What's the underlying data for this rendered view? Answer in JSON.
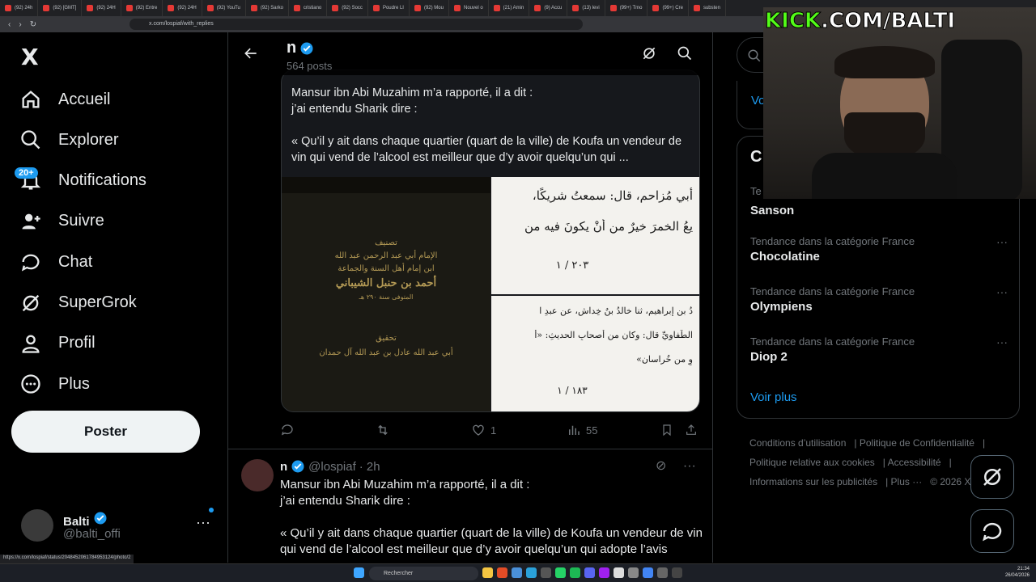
{
  "browser": {
    "tabs": [
      "(92) 24h",
      "(92) [GMT]",
      "(92) 24H",
      "(92) Entre",
      "(92) 24H",
      "(92) YouTu",
      "(92) Sarko",
      "cristiano",
      "(92) Socc",
      "Poudre LI",
      "(92) Mou",
      "Nouvel o",
      "(21) Amin",
      "(9) Accu",
      "(13) levi",
      "(99+) Tmo",
      "(99+) Cre",
      "substen"
    ],
    "url": "x.com/lospiaf/with_replies",
    "status_url": "https://x.com/lospiaf/status/2048452061784953124/photo/2"
  },
  "nav": {
    "logo": "X",
    "items": [
      {
        "label": "Accueil",
        "icon": "home-icon"
      },
      {
        "label": "Explorer",
        "icon": "search-icon"
      },
      {
        "label": "Notifications",
        "icon": "bell-icon"
      },
      {
        "label": "Suivre",
        "icon": "follow-icon"
      },
      {
        "label": "Chat",
        "icon": "chat-icon"
      },
      {
        "label": "SuperGrok",
        "icon": "grok-icon"
      },
      {
        "label": "Profil",
        "icon": "profile-icon"
      },
      {
        "label": "Plus",
        "icon": "more-icon"
      }
    ],
    "notif_badge": "20+",
    "post_label": "Poster",
    "account": {
      "name": "Balti",
      "handle": "@balti_offi"
    }
  },
  "header": {
    "name": "n",
    "posts": "564 posts"
  },
  "tweet1": {
    "quote_text_line1": "Mansur ibn Abi Muzahim m’a rapporté, il a dit :",
    "quote_text_line2": "j’ai entendu Sharik dire :",
    "quote_text_line3": "« Qu’il y ait dans chaque quartier (quart de la ville) de Koufa un vendeur de vin qui vend de l’alcool est meilleur que d’y avoir quelqu’un qui ...",
    "book_cover_line1": "تصنيف",
    "book_cover_line2": "الإمام أبي عبد الرحمن عبد الله",
    "book_cover_line3": "ابن إمام أهل السنة والجماعة",
    "book_cover_line4": "أحمد بن حنبل الشيباني",
    "book_cover_line5": "المتوفى سنة ٢٩٠ هـ",
    "book_cover_line6": "تحقيق",
    "book_cover_line7": "أبي عبد الله عادل بن عبد الله آل حمدان",
    "page_a_line1": "أبي مُزاحم، قال: سمعتُ شريكًا،",
    "page_a_line2": "يعُ الخمرَ خيرٌ من أنْ يكونَ فيه من",
    "page_a_ref": "٢٠٣ / ١",
    "page_b_line1": "دُ بن إبراهيم، ثنا خالدُ بنُ خِداشٍ، عن عبدِ ا",
    "page_b_line2": "الطُّفاوِيِّ قال: وكان من أصحابِ الحديثِ: «أ",
    "page_b_line3": "وِ من خُراسان»",
    "page_b_ref": "١٨٣ / ١",
    "likes": "1",
    "views": "55"
  },
  "tweet2": {
    "name": "n",
    "handle": "@lospiaf",
    "time": "· 2h",
    "line1": "Mansur ibn Abi Muzahim m’a rapporté, il a dit :",
    "line2": "j’ai entendu Sharik dire :",
    "line3": "« Qu’il y ait dans chaque quartier (quart de la ville) de Koufa un vendeur de vin qui vend de l’alcool est meilleur que d’y avoir quelqu’un qui adopte l’avis"
  },
  "right": {
    "voir_top": "Vo",
    "trends_title": "C",
    "trend_top_cat": "Te",
    "trends": [
      {
        "category": "",
        "name": "Sanson"
      },
      {
        "category": "Tendance dans la catégorie France",
        "name": "Chocolatine"
      },
      {
        "category": "Tendance dans la catégorie France",
        "name": "Olympiens"
      },
      {
        "category": "Tendance dans la catégorie France",
        "name": "Diop 2"
      }
    ],
    "voir_plus": "Voir plus",
    "footer": [
      "Conditions d’utilisation",
      "Politique de Confidentialité",
      "Politique relative aux cookies",
      "Accessibilité",
      "Informations sur les publicités",
      "Plus ···",
      "© 2026 X"
    ]
  },
  "overlay": {
    "kick_white": "KICK",
    "kick_rest": ".COM/BALTI"
  },
  "taskbar": {
    "search": "Rechercher",
    "time": "21:34",
    "date": "26/04/2026"
  }
}
